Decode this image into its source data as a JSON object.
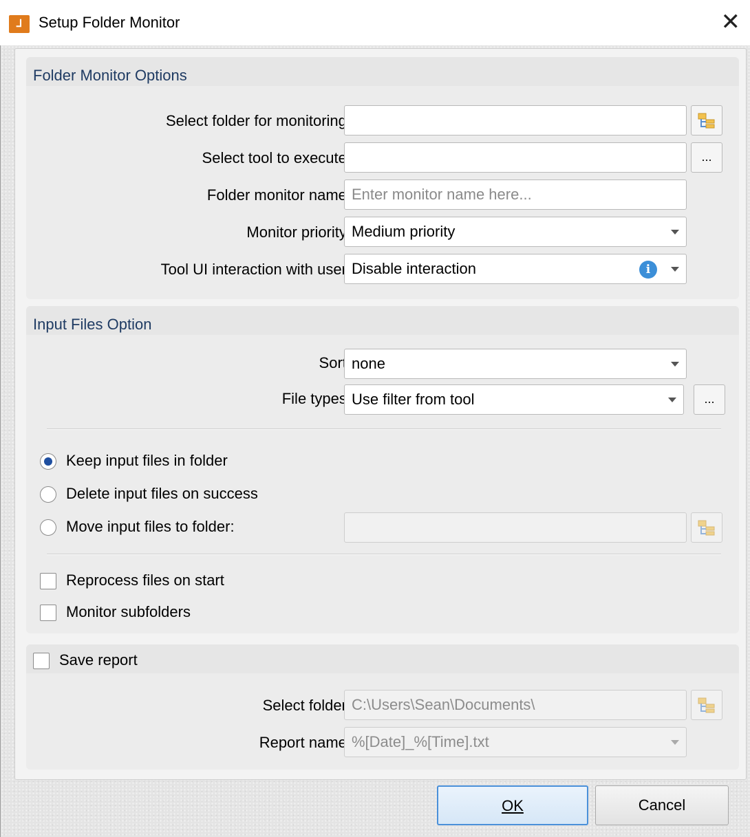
{
  "window": {
    "title": "Setup Folder Monitor",
    "icon": "app-logo-icon",
    "close_symbol": "✕"
  },
  "folder_monitor_options": {
    "header": "Folder Monitor Options",
    "select_folder_label": "Select folder for monitoring:",
    "select_folder_value": "",
    "select_tool_label": "Select tool to execute:",
    "select_tool_value": "",
    "browse_label": "...",
    "monitor_name_label": "Folder monitor name:",
    "monitor_name_placeholder": "Enter monitor name here...",
    "priority_label": "Monitor priority:",
    "priority_value": "Medium priority",
    "interaction_label": "Tool UI interaction with user:",
    "interaction_value": "Disable interaction",
    "info_symbol": "i"
  },
  "input_files_option": {
    "header": "Input Files Option",
    "sort_label": "Sort:",
    "sort_value": "none",
    "file_types_label": "File types:",
    "file_types_value": "Use filter from tool",
    "browse_label": "...",
    "radio_keep": "Keep input files in folder",
    "radio_delete": "Delete input files on success",
    "radio_move": "Move input files to folder:",
    "move_folder_value": "",
    "selected_radio": "keep",
    "reprocess_label": "Reprocess files on start",
    "reprocess_checked": false,
    "subfolders_label": "Monitor subfolders",
    "subfolders_checked": false
  },
  "save_report": {
    "label": "Save report",
    "checked": false,
    "select_folder_label": "Select folder:",
    "select_folder_value": "C:\\Users\\Sean\\Documents\\",
    "report_name_label": "Report name:",
    "report_name_value": "%[Date]_%[Time].txt"
  },
  "buttons": {
    "ok": "OK",
    "cancel": "Cancel"
  },
  "colors": {
    "group_title": "#1f3b63",
    "default_button_border": "#4a90d9",
    "radio_dot": "#1f4fa0",
    "info_icon": "#3c8fd8"
  }
}
